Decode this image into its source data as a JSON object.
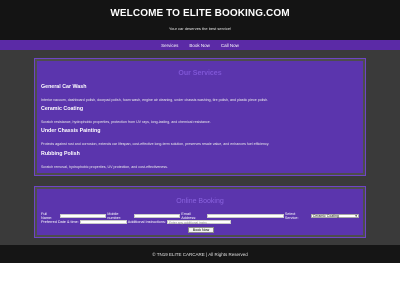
{
  "header": {
    "title": "WELCOME TO ELITE BOOKING.COM",
    "subtitle": "Your car deserves the best service!"
  },
  "nav": {
    "items": [
      {
        "label": "Services"
      },
      {
        "label": "Book Now"
      },
      {
        "label": "Call Now"
      }
    ]
  },
  "services": {
    "title": "Our Services",
    "items": [
      {
        "name": "General Car Wash",
        "desc": "Interior vacuum, dashboard polish, doorpad polish, foam wash, engine air cleaning, under chassis washing, tire polish, and plastic piece polish."
      },
      {
        "name": "Ceramic Coating",
        "desc": "Scratch resistance, hydrophobic properties, protection from UV rays, long-lasting, and chemical resistance."
      },
      {
        "name": "Under Chassis Painting",
        "desc": "Protects against rust and corrosion, extends car lifespan, cost-effective long-term solution, preserves resale value, and enhances fuel efficiency."
      },
      {
        "name": "Rubbing Polish",
        "desc": "Scratch removal, hydrophobic properties, UV protection, and cost-effectiveness."
      }
    ]
  },
  "booking": {
    "title": "Online Booking",
    "fields": {
      "full_name_label": "Full Name:",
      "mobile_label": "Mobile number:",
      "email_label": "Email Address:",
      "select_service_label": "Select Service:",
      "select_service_value": "Ceramic Coating",
      "preferred_date_label": "Preferred Date & time:",
      "additional_instructions_label": "Additional Instructions:",
      "additional_instructions_placeholder": "Enter any additional instru..."
    },
    "submit_label": "Book Now"
  },
  "footer": {
    "text": "© TN19 ELITE CARCARE | All Rights Reserved"
  }
}
